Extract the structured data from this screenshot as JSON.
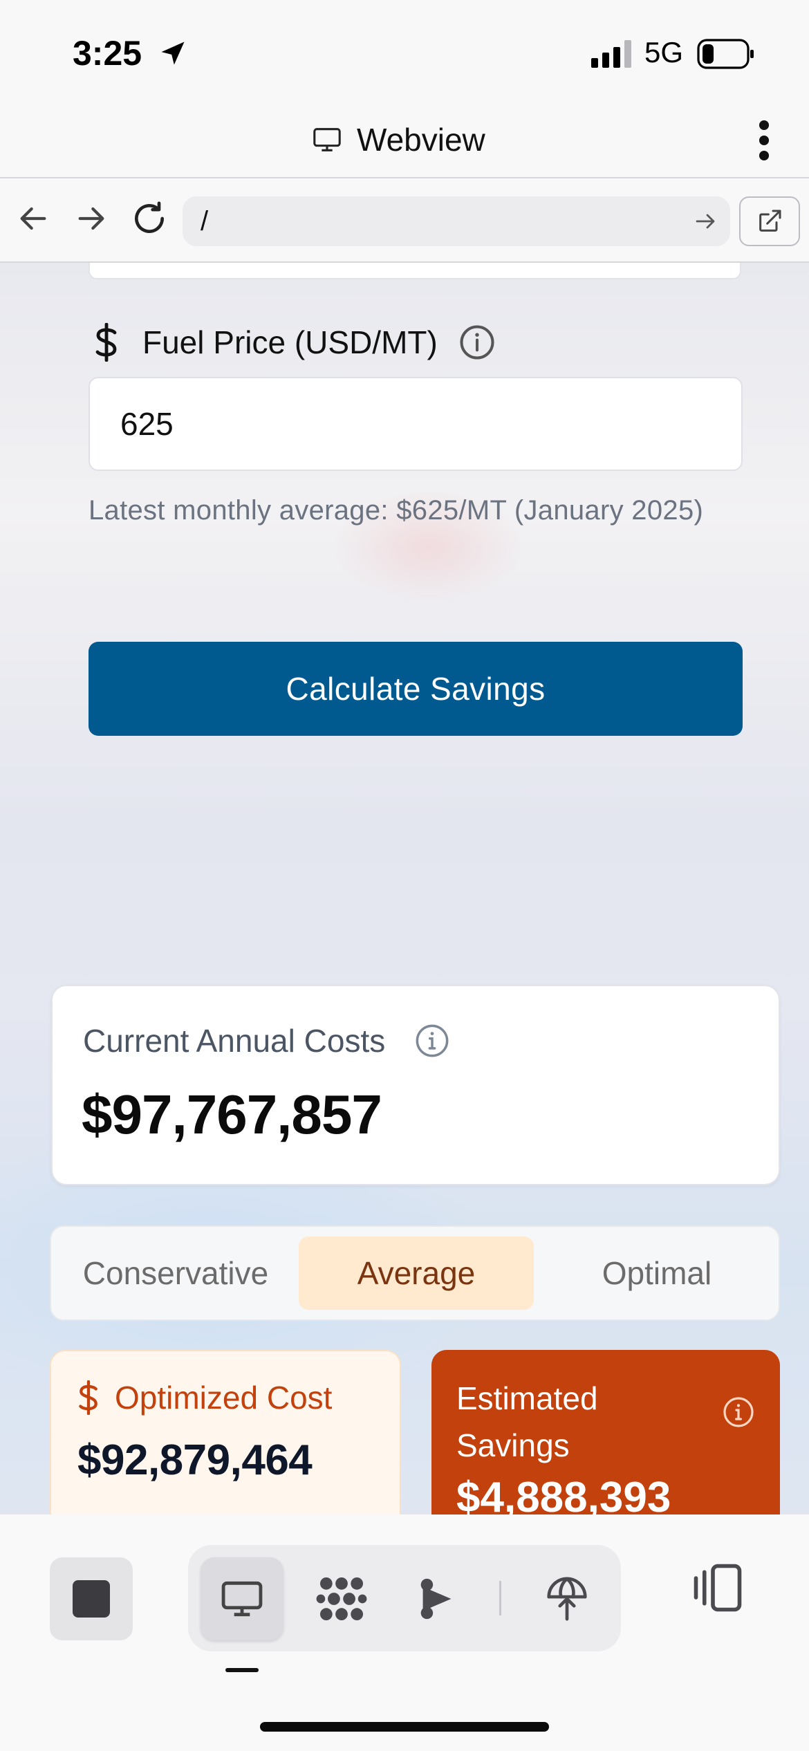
{
  "status": {
    "time": "3:25",
    "network": "5G",
    "icons": [
      "location-arrow-icon",
      "signal-icon",
      "battery-icon"
    ]
  },
  "webview": {
    "title": "Webview",
    "icons": [
      "monitor-icon",
      "more-vertical-icon"
    ]
  },
  "urlbar": {
    "url": "/",
    "icons": [
      "back-arrow-icon",
      "forward-arrow-icon",
      "reload-icon",
      "go-arrow-icon",
      "external-link-icon"
    ]
  },
  "form": {
    "fuel_label": "Fuel Price (USD/MT)",
    "fuel_value": "625",
    "hint": "Latest monthly average: $625/MT (January 2025)",
    "calculate_label": "Calculate Savings"
  },
  "results": {
    "current_title": "Current Annual Costs",
    "current_value": "$97,767,857",
    "tabs": [
      "Conservative",
      "Average",
      "Optimal"
    ],
    "selected_tab": "Average",
    "optimized_title": "Optimized Cost",
    "optimized_value": "$92,879,464",
    "savings_title": "Estimated Savings",
    "savings_value": "$4,888,393"
  },
  "toolbar": {
    "icons": [
      "stop-icon",
      "monitor-icon",
      "grid-dots-icon",
      "share-nodes-icon",
      "globe-upload-icon",
      "side-panel-icon"
    ]
  },
  "colors": {
    "primary_button": "#005a8f",
    "savings_card": "#c2410c",
    "optimized_card": "#fff7ed",
    "selected_tab": "#ffe9cf"
  }
}
